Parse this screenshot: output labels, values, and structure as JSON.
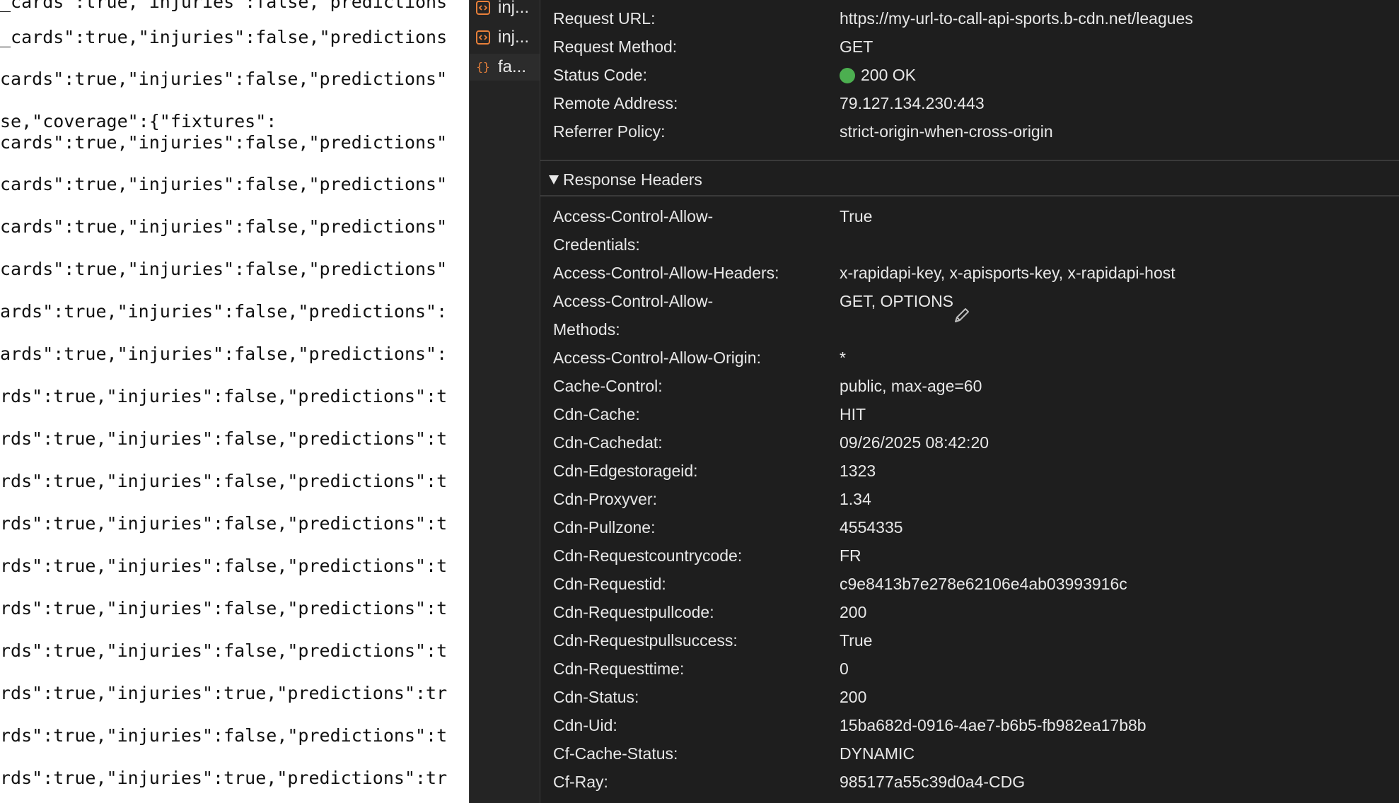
{
  "json_preview": {
    "lines": [
      "_cards\":true,\"injuries\":false,\"predictions",
      "_cards\":true,\"injuries\":false,\"predictions",
      "cards\":true,\"injuries\":false,\"predictions\"",
      "se,\"coverage\":{\"fixtures\":",
      "cards\":true,\"injuries\":false,\"predictions\"",
      "cards\":true,\"injuries\":false,\"predictions\"",
      "cards\":true,\"injuries\":false,\"predictions\"",
      "cards\":true,\"injuries\":false,\"predictions\"",
      "ards\":true,\"injuries\":false,\"predictions\":",
      "ards\":true,\"injuries\":false,\"predictions\":",
      "rds\":true,\"injuries\":false,\"predictions\":t",
      "rds\":true,\"injuries\":false,\"predictions\":t",
      "rds\":true,\"injuries\":false,\"predictions\":t",
      "rds\":true,\"injuries\":false,\"predictions\":t",
      "rds\":true,\"injuries\":false,\"predictions\":t",
      "rds\":true,\"injuries\":false,\"predictions\":t",
      "rds\":true,\"injuries\":false,\"predictions\":t",
      "rds\":true,\"injuries\":true,\"predictions\":tr",
      "rds\":true,\"injuries\":false,\"predictions\":t",
      "rds\":true,\"injuries\":true,\"predictions\":tr"
    ]
  },
  "request_list": {
    "items": [
      {
        "label": "inj...",
        "icon": "document-code-icon",
        "selected": false
      },
      {
        "label": "inj...",
        "icon": "document-code-icon",
        "selected": false
      },
      {
        "label": "fa...",
        "icon": "json-braces-icon",
        "selected": true
      }
    ],
    "icon_color": "#e8803a"
  },
  "general": [
    {
      "name": "Request URL:",
      "value": "https://my-url-to-call-api-sports.b-cdn.net/leagues"
    },
    {
      "name": "Request Method:",
      "value": "GET"
    },
    {
      "name": "Status Code:",
      "value": "200 OK",
      "status_color": "#4caf50"
    },
    {
      "name": "Remote Address:",
      "value": "79.127.134.230:443"
    },
    {
      "name": "Referrer Policy:",
      "value": "strict-origin-when-cross-origin"
    }
  ],
  "response_headers": {
    "title": "Response Headers",
    "expanded": true,
    "rows": [
      {
        "name": "Access-Control-Allow-\nCredentials:",
        "value": "True"
      },
      {
        "name": "Access-Control-Allow-Headers:",
        "value": "x-rapidapi-key, x-apisports-key, x-rapidapi-host"
      },
      {
        "name": "Access-Control-Allow-\nMethods:",
        "value": "GET, OPTIONS"
      },
      {
        "name": "Access-Control-Allow-Origin:",
        "value": "*"
      },
      {
        "name": "Cache-Control:",
        "value": "public, max-age=60"
      },
      {
        "name": "Cdn-Cache:",
        "value": "HIT"
      },
      {
        "name": "Cdn-Cachedat:",
        "value": "09/26/2025 08:42:20"
      },
      {
        "name": "Cdn-Edgestorageid:",
        "value": "1323"
      },
      {
        "name": "Cdn-Proxyver:",
        "value": "1.34"
      },
      {
        "name": "Cdn-Pullzone:",
        "value": "4554335"
      },
      {
        "name": "Cdn-Requestcountrycode:",
        "value": "FR"
      },
      {
        "name": "Cdn-Requestid:",
        "value": "c9e8413b7e278e62106e4ab03993916c"
      },
      {
        "name": "Cdn-Requestpullcode:",
        "value": "200"
      },
      {
        "name": "Cdn-Requestpullsuccess:",
        "value": "True"
      },
      {
        "name": "Cdn-Requesttime:",
        "value": "0"
      },
      {
        "name": "Cdn-Status:",
        "value": "200"
      },
      {
        "name": "Cdn-Uid:",
        "value": "15ba682d-0916-4ae7-b6b5-fb982ea17b8b"
      },
      {
        "name": "Cf-Cache-Status:",
        "value": "DYNAMIC"
      },
      {
        "name": "Cf-Ray:",
        "value": "985177a55c39d0a4-CDG"
      }
    ]
  }
}
